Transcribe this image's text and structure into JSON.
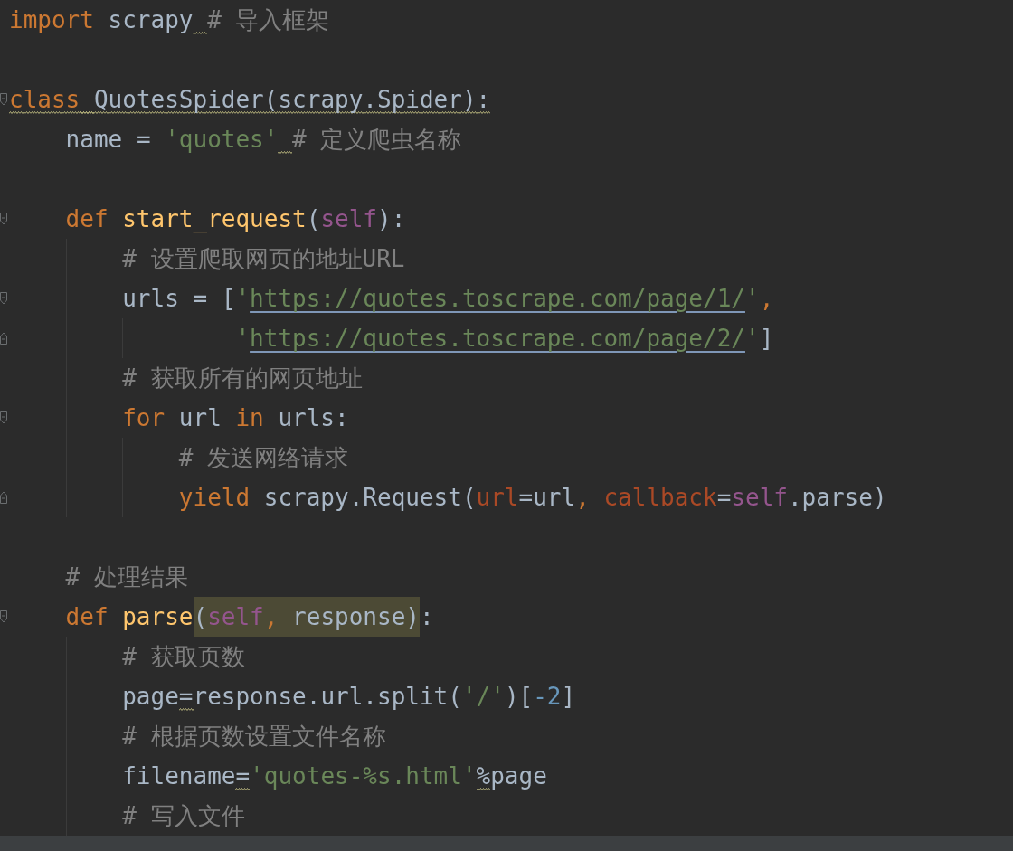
{
  "editor": {
    "lines": [
      {
        "kind": "code",
        "fold_start": false,
        "fold_end": false,
        "words": [
          [
            {
              "text": "import",
              "kind": "keyword"
            }
          ],
          [
            {
              "text": "scrapy",
              "kind": "identifier",
              "squiggle_after": true
            }
          ],
          [
            {
              "text": "# 导入框架",
              "kind": "comment"
            }
          ]
        ]
      },
      {
        "kind": "blank"
      },
      {
        "kind": "code",
        "fold_start": true,
        "fold_end": false,
        "words": [
          [
            {
              "text": "class",
              "kind": "keyword",
              "warning": true,
              "squiggle_after": true
            }
          ],
          [
            {
              "text": "QuotesSpider(scrapy.Spider):",
              "kind": "identifier",
              "warning": true
            }
          ]
        ],
        "children": [
          {
            "kind": "code",
            "fold_start": false,
            "fold_end": false,
            "words": [
              [
                {
                  "text": "name",
                  "kind": "identifier"
                }
              ],
              [
                {
                  "text": "=",
                  "kind": "identifier"
                }
              ],
              [
                {
                  "text": "'quotes'",
                  "kind": "string",
                  "squiggle_after": true
                }
              ],
              [
                {
                  "text": "# 定义爬虫名称",
                  "kind": "comment"
                }
              ]
            ]
          },
          {
            "kind": "blank"
          },
          {
            "kind": "code",
            "fold_start": true,
            "fold_end": false,
            "words": [
              [
                {
                  "text": "def",
                  "kind": "keyword"
                }
              ],
              [
                {
                  "text": "start_request",
                  "kind": "function"
                },
                {
                  "text": "(",
                  "kind": "identifier"
                },
                {
                  "text": "self",
                  "kind": "self"
                },
                {
                  "text": "):",
                  "kind": "identifier"
                }
              ]
            ],
            "children": [
              {
                "kind": "code",
                "fold_start": false,
                "fold_end": false,
                "words": [
                  [
                    {
                      "text": "# 设置爬取网页的地址URL",
                      "kind": "comment"
                    }
                  ]
                ]
              },
              {
                "kind": "code",
                "fold_start": true,
                "fold_end": false,
                "words": [
                  [
                    {
                      "text": "urls",
                      "kind": "identifier"
                    }
                  ],
                  [
                    {
                      "text": "=",
                      "kind": "identifier"
                    }
                  ],
                  [
                    {
                      "text": "[",
                      "kind": "identifier"
                    },
                    {
                      "text": "'",
                      "kind": "string"
                    },
                    {
                      "text": "https://quotes.toscrape.com/page/1/",
                      "kind": "url"
                    },
                    {
                      "text": "'",
                      "kind": "string"
                    },
                    {
                      "text": ",",
                      "kind": "keyword"
                    }
                  ]
                ],
                "children": [
                  {
                    "kind": "continuation",
                    "fold_start": false,
                    "fold_end": true,
                    "words": [
                      [
                        {
                          "text": "'",
                          "kind": "string"
                        },
                        {
                          "text": "https://quotes.toscrape.com/page/2/",
                          "kind": "url"
                        },
                        {
                          "text": "'",
                          "kind": "string"
                        },
                        {
                          "text": "]",
                          "kind": "identifier"
                        }
                      ]
                    ]
                  }
                ]
              },
              {
                "kind": "code",
                "fold_start": false,
                "fold_end": false,
                "words": [
                  [
                    {
                      "text": "# 获取所有的网页地址",
                      "kind": "comment"
                    }
                  ]
                ]
              },
              {
                "kind": "code",
                "fold_start": true,
                "fold_end": false,
                "words": [
                  [
                    {
                      "text": "for",
                      "kind": "keyword"
                    }
                  ],
                  [
                    {
                      "text": "url",
                      "kind": "identifier"
                    }
                  ],
                  [
                    {
                      "text": "in",
                      "kind": "keyword"
                    }
                  ],
                  [
                    {
                      "text": "urls:",
                      "kind": "identifier"
                    }
                  ]
                ],
                "children": [
                  {
                    "kind": "code",
                    "fold_start": false,
                    "fold_end": false,
                    "words": [
                      [
                        {
                          "text": "# 发送网络请求",
                          "kind": "comment"
                        }
                      ]
                    ]
                  },
                  {
                    "kind": "code",
                    "fold_start": false,
                    "fold_end": true,
                    "words": [
                      [
                        {
                          "text": "yield",
                          "kind": "keyword"
                        }
                      ],
                      [
                        {
                          "text": "scrapy.Request(",
                          "kind": "identifier"
                        },
                        {
                          "text": "url",
                          "kind": "parameter"
                        },
                        {
                          "text": "=url",
                          "kind": "identifier"
                        },
                        {
                          "text": ",",
                          "kind": "keyword"
                        }
                      ],
                      [
                        {
                          "text": "callback",
                          "kind": "parameter"
                        },
                        {
                          "text": "=",
                          "kind": "identifier"
                        },
                        {
                          "text": "self",
                          "kind": "self"
                        },
                        {
                          "text": ".parse)",
                          "kind": "identifier"
                        }
                      ]
                    ]
                  }
                ]
              }
            ]
          },
          {
            "kind": "blank"
          },
          {
            "kind": "code",
            "fold_start": false,
            "fold_end": false,
            "words": [
              [
                {
                  "text": "# 处理结果",
                  "kind": "comment"
                }
              ]
            ]
          },
          {
            "kind": "code",
            "fold_start": true,
            "fold_end": false,
            "words": [
              [
                {
                  "text": "def",
                  "kind": "keyword"
                }
              ],
              [
                {
                  "text": "parse",
                  "kind": "function"
                },
                {
                  "text": "(",
                  "kind": "identifier",
                  "highlighted": true
                },
                {
                  "text": "self",
                  "kind": "self",
                  "highlighted": true
                },
                {
                  "text": ",",
                  "kind": "keyword",
                  "highlighted": true
                }
              ],
              [
                {
                  "text": "response",
                  "kind": "identifier",
                  "highlighted": true
                },
                {
                  "text": ")",
                  "kind": "identifier",
                  "highlighted": true
                },
                {
                  "text": ":",
                  "kind": "identifier"
                }
              ]
            ],
            "children": [
              {
                "kind": "code",
                "fold_start": false,
                "fold_end": false,
                "words": [
                  [
                    {
                      "text": "# 获取页数",
                      "kind": "comment"
                    }
                  ]
                ]
              },
              {
                "kind": "code",
                "fold_start": false,
                "fold_end": false,
                "words": [
                  [
                    {
                      "text": "page",
                      "kind": "identifier"
                    },
                    {
                      "text": "=",
                      "kind": "identifier",
                      "warning": true
                    },
                    {
                      "text": "response.url.split(",
                      "kind": "identifier"
                    },
                    {
                      "text": "'/'",
                      "kind": "string"
                    },
                    {
                      "text": ")[",
                      "kind": "identifier"
                    },
                    {
                      "text": "-2",
                      "kind": "number"
                    },
                    {
                      "text": "]",
                      "kind": "identifier"
                    }
                  ]
                ]
              },
              {
                "kind": "code",
                "fold_start": false,
                "fold_end": false,
                "words": [
                  [
                    {
                      "text": "# 根据页数设置文件名称",
                      "kind": "comment"
                    }
                  ]
                ]
              },
              {
                "kind": "code",
                "fold_start": false,
                "fold_end": false,
                "words": [
                  [
                    {
                      "text": "filename",
                      "kind": "identifier"
                    },
                    {
                      "text": "=",
                      "kind": "identifier",
                      "warning": true
                    },
                    {
                      "text": "'quotes-%s.html'",
                      "kind": "string"
                    },
                    {
                      "text": "%",
                      "kind": "identifier",
                      "warning": true
                    },
                    {
                      "text": "page",
                      "kind": "identifier"
                    }
                  ]
                ]
              },
              {
                "kind": "code",
                "fold_start": false,
                "fold_end": false,
                "words": [
                  [
                    {
                      "text": "# 写入文件",
                      "kind": "comment"
                    }
                  ]
                ]
              }
            ]
          }
        ]
      }
    ]
  }
}
